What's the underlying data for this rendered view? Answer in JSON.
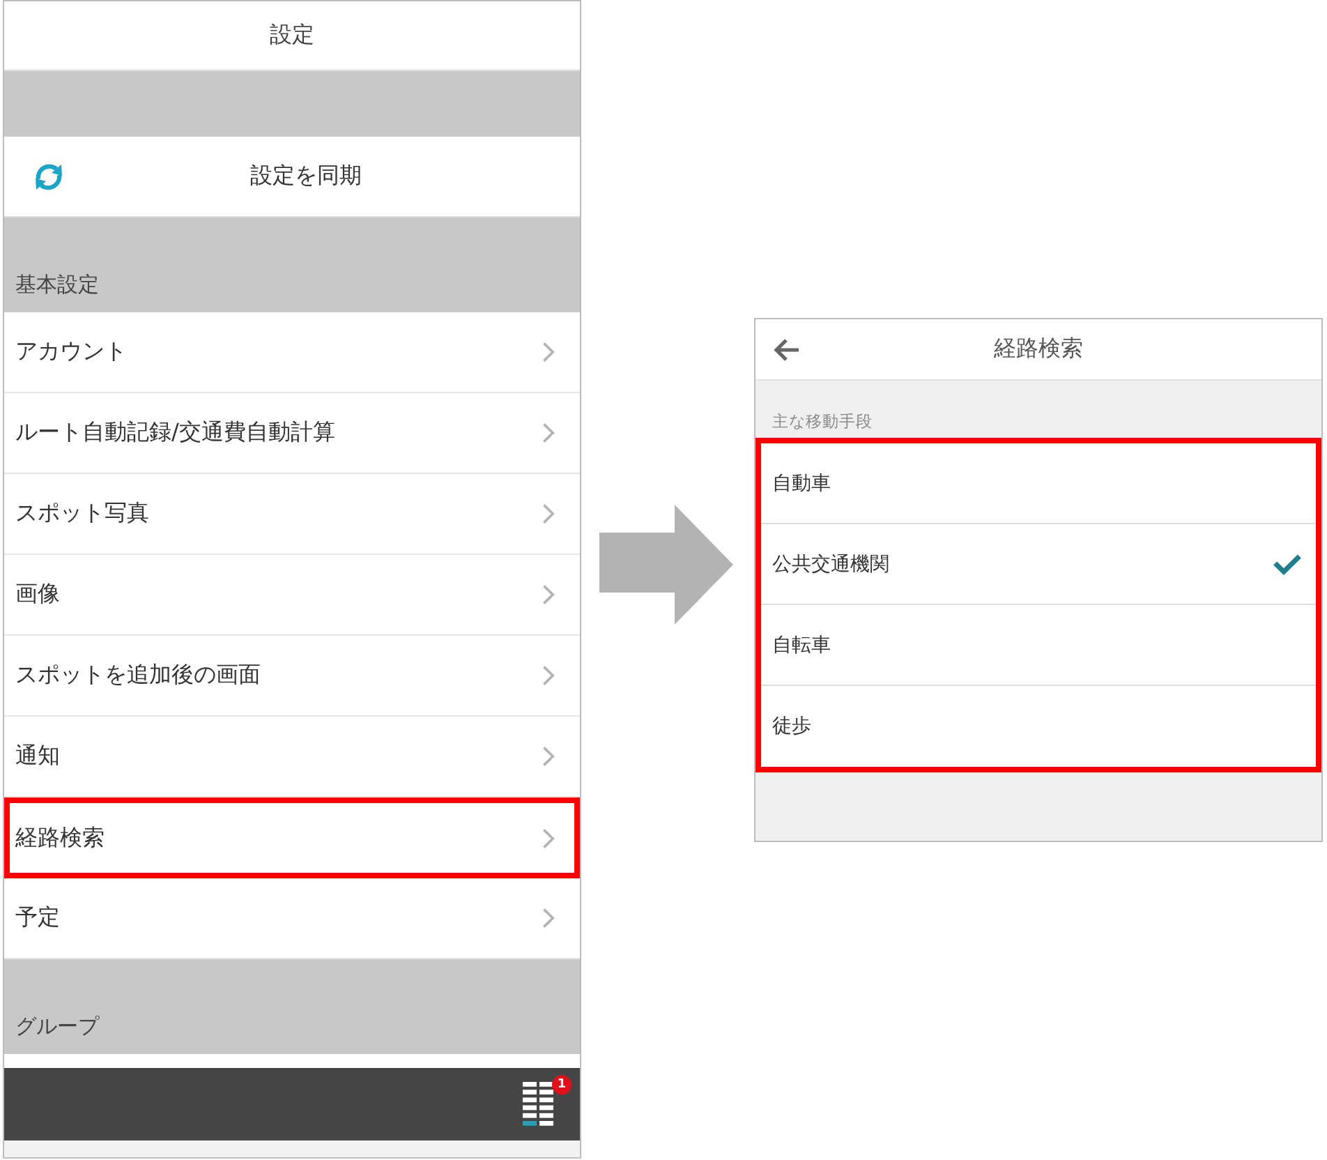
{
  "settings_screen": {
    "title": "設定",
    "sync_button": "設定を同期",
    "sections": [
      {
        "header": "基本設定",
        "items": [
          {
            "label": "アカウント",
            "highlighted": false
          },
          {
            "label": "ルート自動記録/交通費自動計算",
            "highlighted": false
          },
          {
            "label": "スポット写真",
            "highlighted": false
          },
          {
            "label": "画像",
            "highlighted": false
          },
          {
            "label": "スポットを追加後の画面",
            "highlighted": false
          },
          {
            "label": "通知",
            "highlighted": false
          },
          {
            "label": "経路検索",
            "highlighted": true
          },
          {
            "label": "予定",
            "highlighted": false
          }
        ]
      },
      {
        "header": "グループ"
      }
    ],
    "bottom_bar": {
      "badge": "1"
    }
  },
  "route_search_screen": {
    "title": "経路検索",
    "section_label": "主な移動手段",
    "options_highlighted": true,
    "options": [
      {
        "label": "自動車",
        "selected": false
      },
      {
        "label": "公共交通機関",
        "selected": true
      },
      {
        "label": "自転車",
        "selected": false
      },
      {
        "label": "徒歩",
        "selected": false
      }
    ]
  }
}
